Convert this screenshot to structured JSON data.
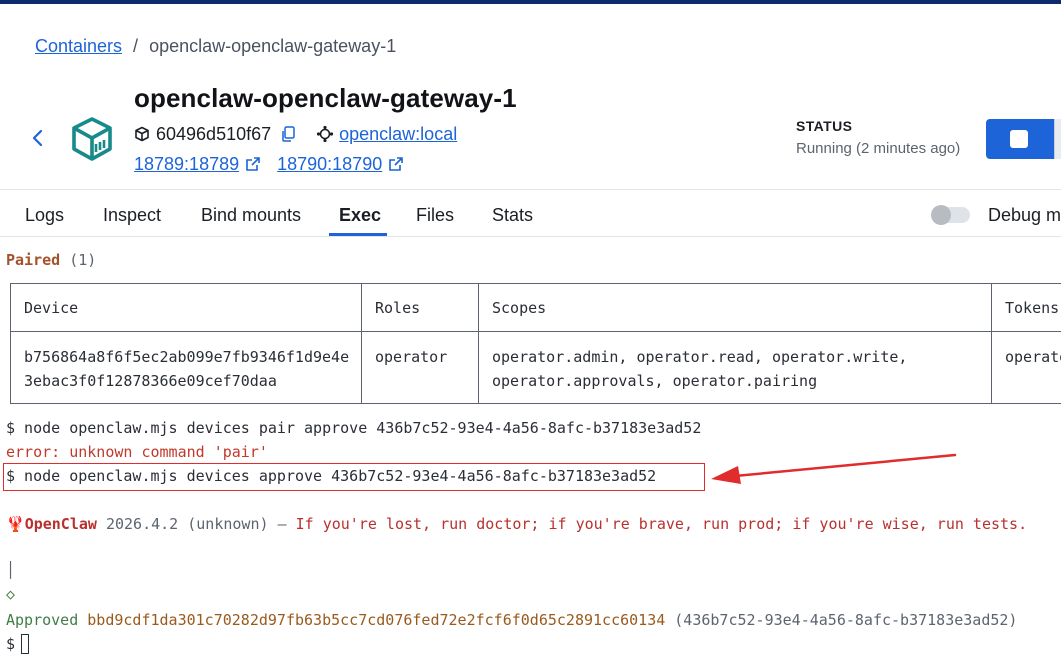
{
  "breadcrumb": {
    "root": "Containers",
    "separator": "/",
    "current": "openclaw-openclaw-gateway-1"
  },
  "container": {
    "title": "openclaw-openclaw-gateway-1",
    "id": "60496d510f67",
    "image": "openclaw:local",
    "ports": [
      "18789:18789",
      "18790:18790"
    ]
  },
  "status": {
    "label": "STATUS",
    "value": "Running (2 minutes ago)"
  },
  "tabs": [
    {
      "label": "Logs",
      "active": false
    },
    {
      "label": "Inspect",
      "active": false
    },
    {
      "label": "Bind mounts",
      "active": false
    },
    {
      "label": "Exec",
      "active": true
    },
    {
      "label": "Files",
      "active": false
    },
    {
      "label": "Stats",
      "active": false
    }
  ],
  "debug_mode": {
    "label": "Debug m",
    "enabled": false
  },
  "terminal": {
    "paired_label": "Paired",
    "paired_count": "(1)",
    "table": {
      "headers": [
        "Device",
        "Roles",
        "Scopes",
        "Tokens"
      ],
      "row": {
        "device": "b756864a8f6f5ec2ab099e7fb9346f1d9e4e\n3ebac3f0f12878366e09cef70daa",
        "roles": "operator",
        "scopes": "operator.admin, operator.read, operator.write,\noperator.approvals, operator.pairing",
        "tokens": "operato"
      }
    },
    "cmd1": "$ node openclaw.mjs devices pair approve 436b7c52-93e4-4a56-8afc-b37183e3ad52",
    "error": "error: unknown command 'pair'",
    "cmd2": "$ node openclaw.mjs devices approve 436b7c52-93e4-4a56-8afc-b37183e3ad52",
    "banner": {
      "emoji": "🦞",
      "name": "OpenClaw",
      "version": "2026.4.2",
      "build": "(unknown)",
      "dash": "—",
      "tagline": "If you're lost, run doctor; if you're brave, run prod; if you're wise, run tests."
    },
    "pipe": "│",
    "diamond": "◇",
    "approved_label": "Approved",
    "approved_hash": "bbd9cdf1da301c70282d97fb63b5cc7cd076fed72e2fcf6f0d65c2891cc60134",
    "approved_id": "(436b7c52-93e4-4a56-8afc-b37183e3ad52)",
    "prompt": "$"
  },
  "colors": {
    "accent": "#1c64d8",
    "paired": "#a3532b",
    "error": "#c0392b",
    "banner_red": "#b8312f",
    "approved_green": "#3f7d45",
    "hash_brown": "#9a5a1d",
    "annotation_red": "#e02c2c"
  },
  "icons": [
    "chevron-left-icon",
    "container-cube-icon",
    "box-icon",
    "copy-icon",
    "image-node-icon",
    "external-link-icon",
    "stop-icon"
  ]
}
